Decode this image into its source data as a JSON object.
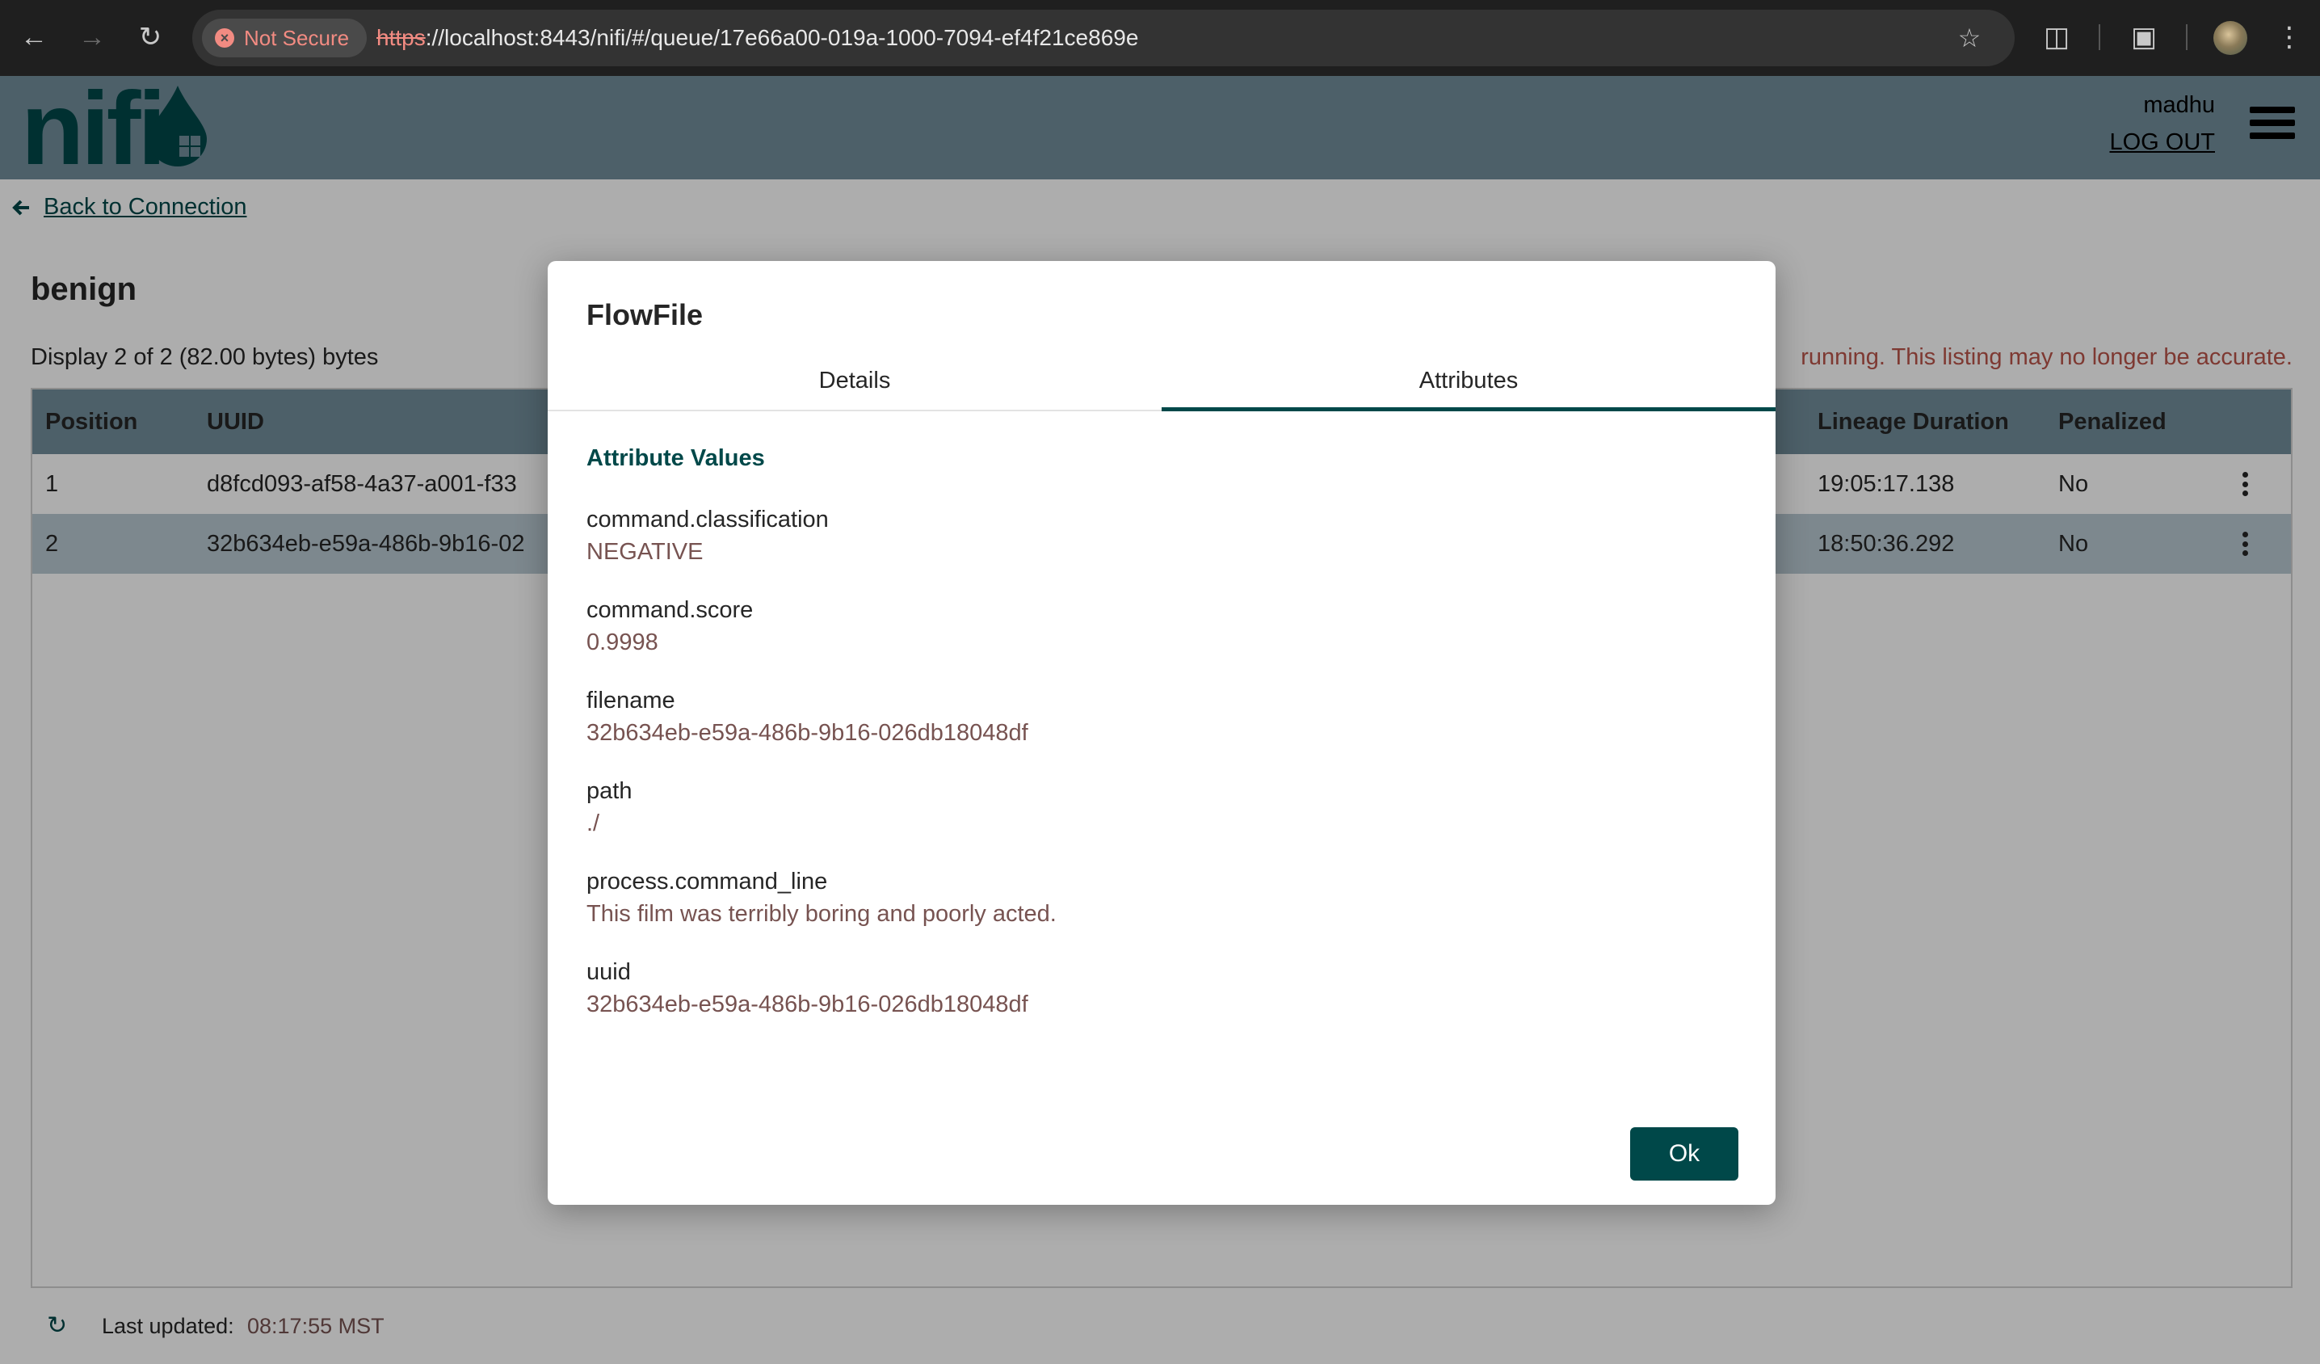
{
  "browser": {
    "security_label": "Not Secure",
    "url_scheme": "https",
    "url_rest": "://localhost:8443/nifi/#/queue/17e66a00-019a-1000-7094-ef4f21ce869e"
  },
  "header": {
    "logo_text": "nifi",
    "user": "madhu",
    "logout_label": "LOG OUT"
  },
  "page": {
    "back_label": "Back to Connection",
    "title": "benign",
    "display_summary": "Display 2 of 2 (82.00 bytes) bytes",
    "warning": "running. This listing may no longer be accurate."
  },
  "table": {
    "columns": [
      "Position",
      "UUID",
      "Lineage Duration",
      "Penalized"
    ],
    "rows": [
      {
        "position": "1",
        "uuid": "d8fcd093-af58-4a37-a001-f33",
        "lineage": "19:05:17.138",
        "penalized": "No"
      },
      {
        "position": "2",
        "uuid": "32b634eb-e59a-486b-9b16-02",
        "lineage": "18:50:36.292",
        "penalized": "No"
      }
    ]
  },
  "footer": {
    "last_updated_label": "Last updated:",
    "last_updated_value": "08:17:55 MST"
  },
  "dialog": {
    "title": "FlowFile",
    "tabs": [
      "Details",
      "Attributes"
    ],
    "active_tab": "Attributes",
    "section_heading": "Attribute Values",
    "attributes": [
      {
        "name": "command.classification",
        "value": "NEGATIVE"
      },
      {
        "name": "command.score",
        "value": "0.9998"
      },
      {
        "name": "filename",
        "value": "32b634eb-e59a-486b-9b16-026db18048df"
      },
      {
        "name": "path",
        "value": "./"
      },
      {
        "name": "process.command_line",
        "value": "This film was terribly boring and poorly acted."
      },
      {
        "name": "uuid",
        "value": "32b634eb-e59a-486b-9b16-026db18048df"
      }
    ],
    "ok_label": "Ok"
  },
  "colors": {
    "header_bg": "#728e9b",
    "brand_dark": "#004849",
    "value_text": "#775351",
    "warning_text": "#ba554a"
  }
}
